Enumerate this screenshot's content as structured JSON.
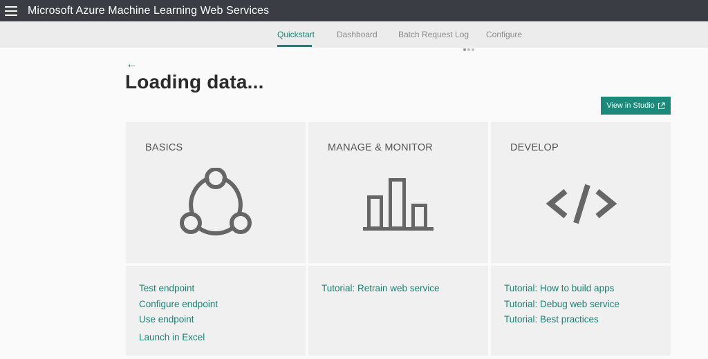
{
  "header": {
    "title": "Microsoft Azure Machine Learning Web Services",
    "menu_icon": "hamburger-menu-icon"
  },
  "tabs": [
    {
      "label": "Quickstart",
      "active": true
    },
    {
      "label": "Dashboard",
      "active": false
    },
    {
      "label": "Batch Request Log",
      "active": false
    },
    {
      "label": "Configure",
      "active": false
    }
  ],
  "page": {
    "back_label": "←",
    "title": "Loading data...",
    "view_button": "View in Studio",
    "view_button_icon": "external-link-icon"
  },
  "cards": [
    {
      "title": "BASICS",
      "icon": "connected-nodes-icon",
      "links": [
        "Test endpoint",
        "Configure endpoint",
        "Use endpoint",
        "Launch in Excel"
      ]
    },
    {
      "title": "MANAGE & MONITOR",
      "icon": "bar-chart-icon",
      "links": [
        "Tutorial: Retrain web service"
      ]
    },
    {
      "title": "DEVELOP",
      "icon": "code-icon",
      "links": [
        "Tutorial: How to build apps",
        "Tutorial: Debug web service",
        "Tutorial: Best practices"
      ]
    }
  ],
  "colors": {
    "accent": "#1c7f74",
    "topbar": "#3a3d43",
    "card_bg": "#f0f0f0"
  }
}
